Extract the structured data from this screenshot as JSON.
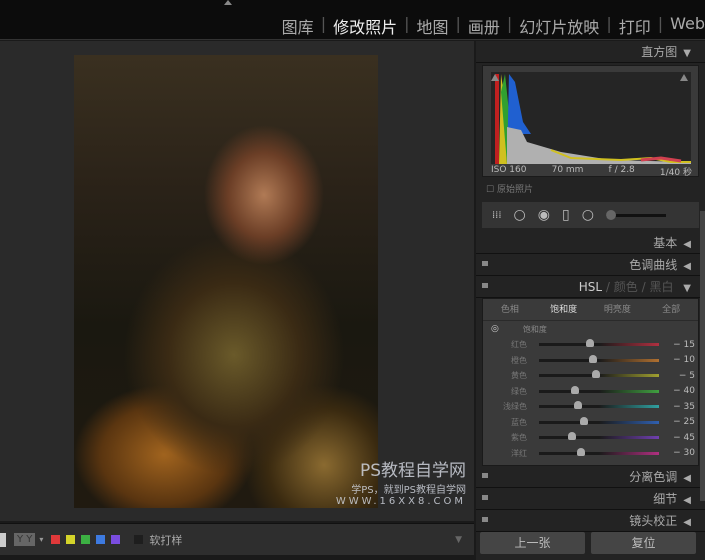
{
  "nav": {
    "items": [
      "图库",
      "修改照片",
      "地图",
      "画册",
      "幻灯片放映",
      "打印",
      "Web"
    ],
    "active": 1
  },
  "watermark": {
    "title": "PS教程自学网",
    "subtitle": "学PS，就到PS教程自学网",
    "url": "WWW.16XX8.COM"
  },
  "toolbar": {
    "yy": "Y Y",
    "soft_proof": "软打样",
    "color_labels": [
      "#e0393a",
      "#d4d42a",
      "#3cb043",
      "#3d7ae0",
      "#7a4de0"
    ]
  },
  "panel": {
    "histogram": {
      "title": "直方图",
      "iso": "ISO 160",
      "focal": "70 mm",
      "aperture": "f / 2.8",
      "shutter": "1/40 秒",
      "original": "原始照片"
    },
    "basic": "基本",
    "tone_curve": "色调曲线",
    "hsl_header": {
      "hsl": "HSL",
      "color": "颜色",
      "bw": "黑白",
      "sep": "/"
    },
    "hsl_tabs": [
      "色相",
      "饱和度",
      "明亮度",
      "全部"
    ],
    "hsl_active_tab": 1,
    "section_title": "饱和度",
    "sliders": [
      {
        "label": "红色",
        "value": -15,
        "display": "− 15",
        "color": "#b03040"
      },
      {
        "label": "橙色",
        "value": -10,
        "display": "− 10",
        "color": "#b07030"
      },
      {
        "label": "黄色",
        "value": -5,
        "display": "− 5",
        "color": "#a0a030"
      },
      {
        "label": "绿色",
        "value": -40,
        "display": "− 40",
        "color": "#40a040"
      },
      {
        "label": "浅绿色",
        "value": -35,
        "display": "− 35",
        "color": "#30a0a0"
      },
      {
        "label": "蓝色",
        "value": -25,
        "display": "− 25",
        "color": "#3060b0"
      },
      {
        "label": "紫色",
        "value": -45,
        "display": "− 45",
        "color": "#7040b0"
      },
      {
        "label": "洋红",
        "value": -30,
        "display": "− 30",
        "color": "#b03080"
      }
    ],
    "split_toning": "分离色调",
    "detail": "细节",
    "lens": "镜头校正",
    "prev": "上一张",
    "reset": "复位"
  }
}
